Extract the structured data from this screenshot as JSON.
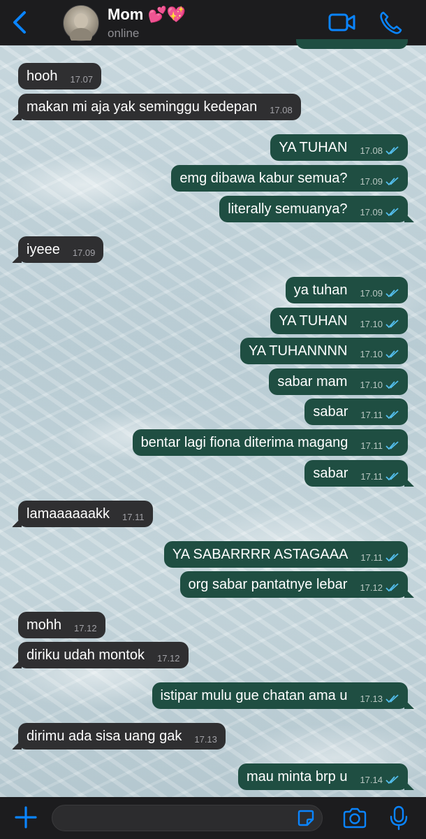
{
  "header": {
    "contact_name": "Mom 💕💖",
    "status": "online"
  },
  "colors": {
    "accent": "#0a84ff",
    "incoming_bubble": "#2f2f31",
    "outgoing_bubble": "#1f4e42",
    "read_ticks": "#53bdeb"
  },
  "messages": [
    {
      "dir": "in",
      "text": "hooh",
      "time": "17.07"
    },
    {
      "dir": "in",
      "text": "makan mi aja yak seminggu kedepan",
      "time": "17.08"
    },
    {
      "dir": "out",
      "text": "YA TUHAN",
      "time": "17.08"
    },
    {
      "dir": "out",
      "text": "emg dibawa kabur semua?",
      "time": "17.09"
    },
    {
      "dir": "out",
      "text": "literally semuanya?",
      "time": "17.09"
    },
    {
      "dir": "in",
      "text": "iyeee",
      "time": "17.09"
    },
    {
      "dir": "out",
      "text": "ya tuhan",
      "time": "17.09"
    },
    {
      "dir": "out",
      "text": "YA TUHAN",
      "time": "17.10"
    },
    {
      "dir": "out",
      "text": "YA TUHANNNN",
      "time": "17.10"
    },
    {
      "dir": "out",
      "text": "sabar mam",
      "time": "17.10"
    },
    {
      "dir": "out",
      "text": "sabar",
      "time": "17.11"
    },
    {
      "dir": "out",
      "text": "bentar lagi fiona diterima magang",
      "time": "17.11"
    },
    {
      "dir": "out",
      "text": "sabar",
      "time": "17.11"
    },
    {
      "dir": "in",
      "text": "lamaaaaaakk",
      "time": "17.11"
    },
    {
      "dir": "out",
      "text": "YA SABARRRR ASTAGAAA",
      "time": "17.11"
    },
    {
      "dir": "out",
      "text": "org sabar pantatnye lebar",
      "time": "17.12"
    },
    {
      "dir": "in",
      "text": "mohh",
      "time": "17.12"
    },
    {
      "dir": "in",
      "text": "diriku udah montok",
      "time": "17.12"
    },
    {
      "dir": "out",
      "text": "istipar mulu gue chatan ama u",
      "time": "17.13"
    },
    {
      "dir": "in",
      "text": "dirimu ada sisa uang gak",
      "time": "17.13"
    },
    {
      "dir": "out",
      "text": "mau minta brp u",
      "time": "17.14"
    }
  ],
  "composer": {
    "value": "",
    "placeholder": ""
  }
}
